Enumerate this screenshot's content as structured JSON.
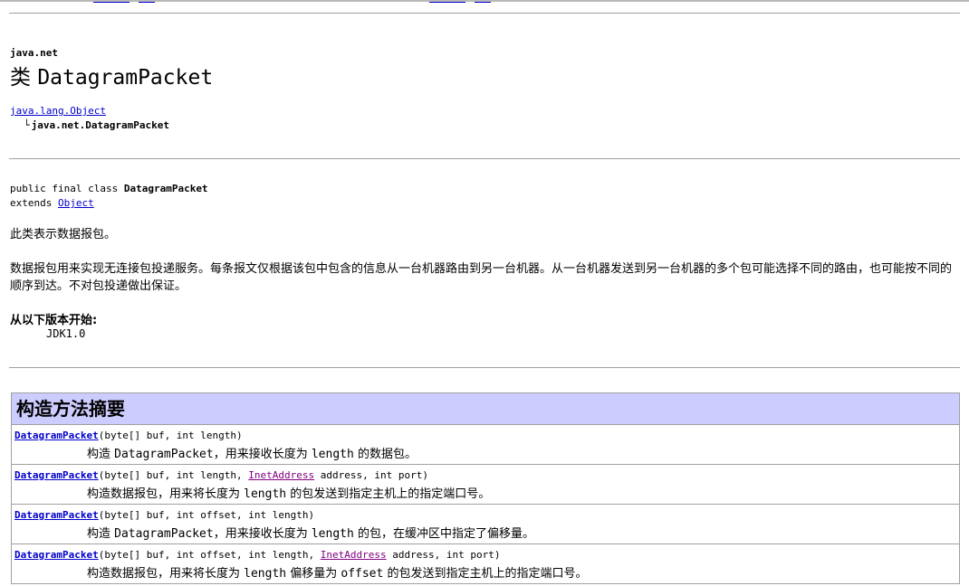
{
  "package": "java.net",
  "class_title": {
    "keyword": "类",
    "name": "DatagramPacket"
  },
  "inheritance": {
    "root": "java.lang.Object",
    "branch": "└",
    "child": "java.net.DatagramPacket"
  },
  "declaration": {
    "modifiers": "public final class",
    "class_name": "DatagramPacket",
    "extends_keyword": "extends",
    "superclass": "Object"
  },
  "description": {
    "short": "此类表示数据报包。",
    "long": "数据报包用来实现无连接包投递服务。每条报文仅根据该包中包含的信息从一台机器路由到另一台机器。从一台机器发送到另一台机器的多个包可能选择不同的路由，也可能按不同的顺序到达。不对包投递做出保证。"
  },
  "since": {
    "label": "从以下版本开始:",
    "value": "JDK1.0"
  },
  "constructor_summary": {
    "title": "构造方法摘要",
    "rows": [
      {
        "name": "DatagramPacket",
        "params_1": "(byte[] buf, int length)",
        "link_type": "",
        "params_2": "",
        "desc_1": "构造 ",
        "desc_code_1": "DatagramPacket",
        "desc_2": "，用来接收长度为 ",
        "desc_code_2": "length",
        "desc_3": " 的数据包。",
        "desc_code_3": "",
        "desc_4": ""
      },
      {
        "name": "DatagramPacket",
        "params_1": "(byte[] buf, int length, ",
        "link_type": "InetAddress",
        "params_2": " address, int port)",
        "desc_1": "构造数据报包，用来将长度为 ",
        "desc_code_1": "length",
        "desc_2": " 的包发送到指定主机上的指定端口号。",
        "desc_code_2": "",
        "desc_3": "",
        "desc_code_3": "",
        "desc_4": ""
      },
      {
        "name": "DatagramPacket",
        "params_1": "(byte[] buf, int offset, int length)",
        "link_type": "",
        "params_2": "",
        "desc_1": "构造 ",
        "desc_code_1": "DatagramPacket",
        "desc_2": "，用来接收长度为 ",
        "desc_code_2": "length",
        "desc_3": " 的包，在缓冲区中指定了偏移量。",
        "desc_code_3": "",
        "desc_4": ""
      },
      {
        "name": "DatagramPacket",
        "params_1": "(byte[] buf, int offset, int length, ",
        "link_type": "InetAddress",
        "params_2": " address, int port)",
        "desc_1": "构造数据报包，用来将长度为 ",
        "desc_code_1": "length",
        "desc_2": " 偏移量为 ",
        "desc_code_2": "offset",
        "desc_3": " 的包发送到指定主机上的指定端口号。",
        "desc_code_3": "",
        "desc_4": ""
      }
    ]
  }
}
